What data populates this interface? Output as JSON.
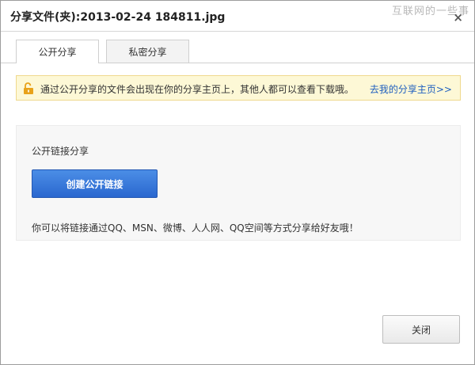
{
  "title": "分享文件(夹):2013-02-24 184811.jpg",
  "watermark": "互联网的一些事",
  "close_glyph": "×",
  "tabs": [
    {
      "label": "公开分享",
      "active": true
    },
    {
      "label": "私密分享",
      "active": false
    }
  ],
  "notice": {
    "text": "通过公开分享的文件会出现在你的分享主页上，其他人都可以查看下载哦。",
    "link": "去我的分享主页>>"
  },
  "panel": {
    "label": "公开链接分享",
    "create_button": "创建公开链接",
    "description": "你可以将链接通过QQ、MSN、微博、人人网、QQ空间等方式分享给好友哦！"
  },
  "footer": {
    "close_button": "关闭"
  },
  "colors": {
    "primary_button": "#2a67cf",
    "link": "#1f5fbf",
    "notice_bg": "#fdf8d6",
    "notice_border": "#efd98d",
    "lock_icon": "#e8a21a"
  },
  "icons": {
    "notice": "unlock-icon",
    "close": "close-icon"
  }
}
